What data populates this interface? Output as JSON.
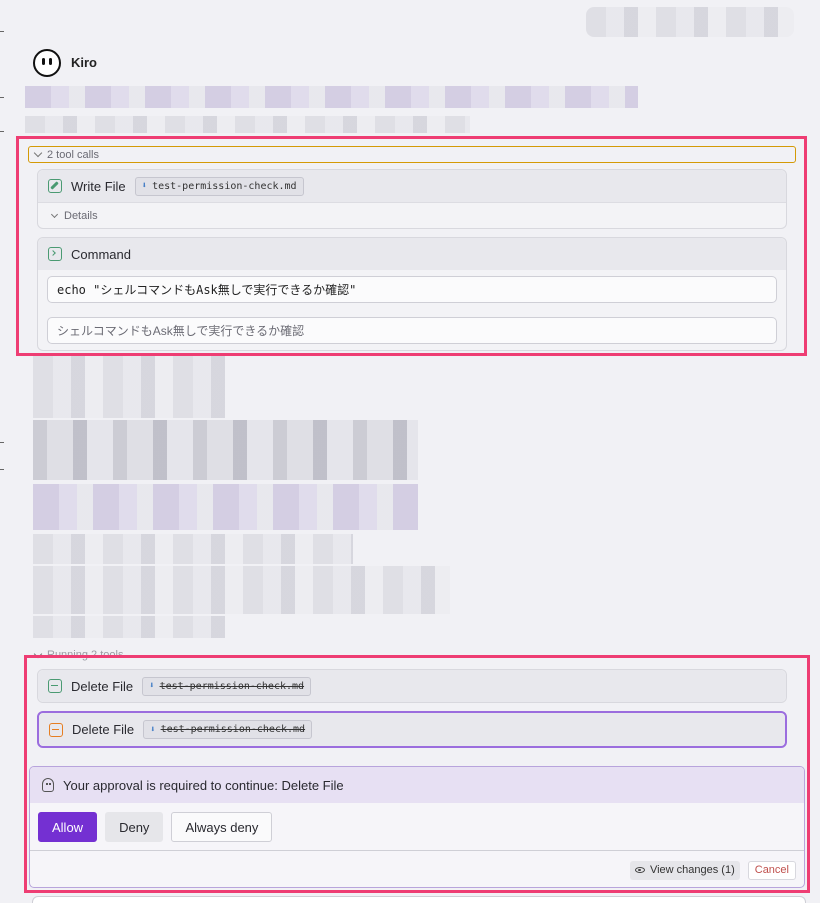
{
  "assistant": {
    "name": "Kiro"
  },
  "tool_group_1": {
    "toggle_label": "2 tool calls",
    "write_file": {
      "title": "Write File",
      "file_name": "test-permission-check.md",
      "file_icon": "markdown-file-icon",
      "details_label": "Details"
    },
    "command": {
      "title": "Command",
      "command_text": "echo \"シェルコマンドもAsk無しで実行できるか確認\"",
      "description": "シェルコマンドもAsk無しで実行できるか確認"
    }
  },
  "tool_group_2": {
    "running_label": "Running 2 tools",
    "delete_1": {
      "title": "Delete File",
      "file_name": "test-permission-check.md"
    },
    "delete_2": {
      "title": "Delete File",
      "file_name": "test-permission-check.md"
    }
  },
  "approval": {
    "message": "Your approval is required to continue: Delete File",
    "allow_label": "Allow",
    "deny_label": "Deny",
    "always_deny_label": "Always deny",
    "view_changes_label": "View changes (1)",
    "cancel_label": "Cancel"
  },
  "colors": {
    "highlight": "#ee3d73",
    "accent": "#7430d2",
    "icon_green": "#4a9a72",
    "icon_orange": "#e67e22",
    "toggle_border": "#d49a06"
  }
}
